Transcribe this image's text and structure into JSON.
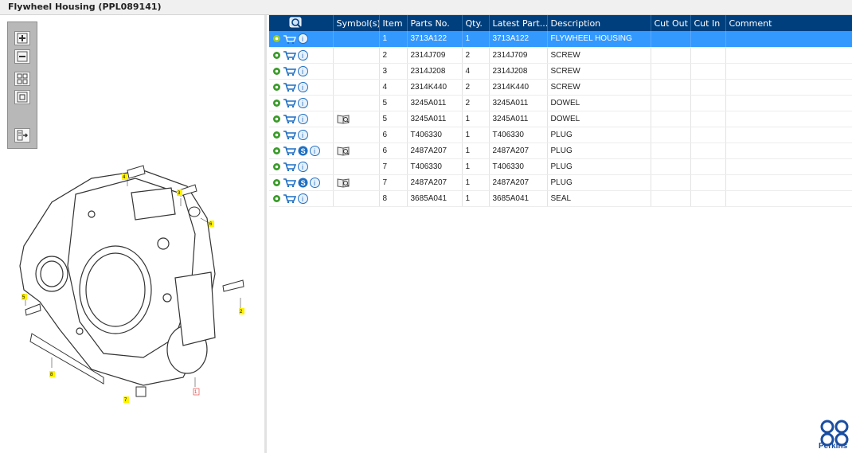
{
  "window": {
    "title": "Flywheel Housing (PPL089141)"
  },
  "toolbar": {
    "buttons": [
      "zoom-in-icon",
      "zoom-out-icon",
      "fit-icon",
      "actual-size-icon",
      "export-icon"
    ]
  },
  "table": {
    "headers": [
      "",
      "Symbol(s)",
      "Item",
      "Parts No.",
      "Qty.",
      "Latest Part...",
      "Description",
      "Cut Out",
      "Cut In",
      "Comment"
    ],
    "rows": [
      {
        "item": "1",
        "part": "3713A122",
        "qty": "1",
        "latest": "3713A122",
        "desc": "FLYWHEEL HOUSING",
        "s_icon": false,
        "symbol": false,
        "selected": true
      },
      {
        "item": "2",
        "part": "2314J709",
        "qty": "2",
        "latest": "2314J709",
        "desc": "SCREW",
        "s_icon": false,
        "symbol": false,
        "selected": false
      },
      {
        "item": "3",
        "part": "2314J208",
        "qty": "4",
        "latest": "2314J208",
        "desc": "SCREW",
        "s_icon": false,
        "symbol": false,
        "selected": false
      },
      {
        "item": "4",
        "part": "2314K440",
        "qty": "2",
        "latest": "2314K440",
        "desc": "SCREW",
        "s_icon": false,
        "symbol": false,
        "selected": false
      },
      {
        "item": "5",
        "part": "3245A011",
        "qty": "2",
        "latest": "3245A011",
        "desc": "DOWEL",
        "s_icon": false,
        "symbol": false,
        "selected": false
      },
      {
        "item": "5",
        "part": "3245A011",
        "qty": "1",
        "latest": "3245A011",
        "desc": "DOWEL",
        "s_icon": false,
        "symbol": true,
        "selected": false
      },
      {
        "item": "6",
        "part": "T406330",
        "qty": "1",
        "latest": "T406330",
        "desc": "PLUG",
        "s_icon": false,
        "symbol": false,
        "selected": false
      },
      {
        "item": "6",
        "part": "2487A207",
        "qty": "1",
        "latest": "2487A207",
        "desc": "PLUG",
        "s_icon": true,
        "symbol": true,
        "selected": false
      },
      {
        "item": "7",
        "part": "T406330",
        "qty": "1",
        "latest": "T406330",
        "desc": "PLUG",
        "s_icon": false,
        "symbol": false,
        "selected": false
      },
      {
        "item": "7",
        "part": "2487A207",
        "qty": "1",
        "latest": "2487A207",
        "desc": "PLUG",
        "s_icon": true,
        "symbol": true,
        "selected": false
      },
      {
        "item": "8",
        "part": "3685A041",
        "qty": "1",
        "latest": "3685A041",
        "desc": "SEAL",
        "s_icon": false,
        "symbol": false,
        "selected": false
      }
    ]
  },
  "drawing": {
    "callouts": [
      "4",
      "3",
      "6",
      "5",
      "2",
      "8",
      "7",
      "1"
    ]
  },
  "logo": {
    "text": "Perkins"
  },
  "colors": {
    "header": "#003f7d",
    "selected": "#3399ff",
    "brand": "#1a4ea1"
  }
}
